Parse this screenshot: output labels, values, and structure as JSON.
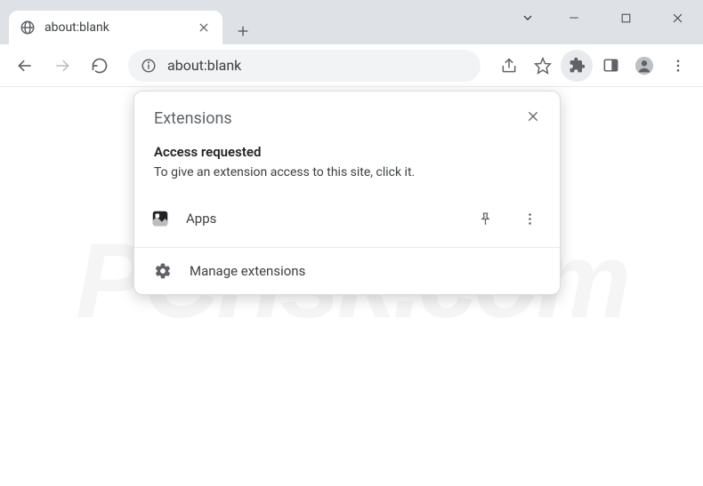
{
  "tab": {
    "title": "about:blank"
  },
  "addressbar": {
    "text": "about:blank"
  },
  "popup": {
    "title": "Extensions",
    "section_title": "Access requested",
    "section_desc": "To give an extension access to this site, click it.",
    "extension_name": "Apps",
    "manage_label": "Manage extensions"
  },
  "watermark": "PCrisk.com"
}
